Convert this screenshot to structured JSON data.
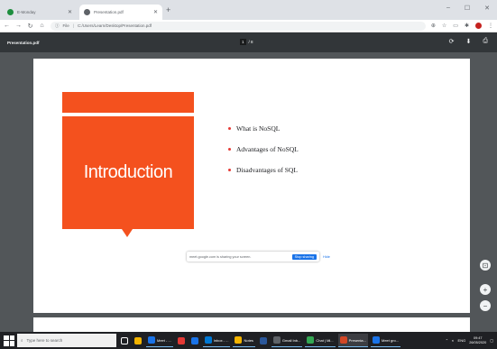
{
  "browser": {
    "tabs": [
      {
        "title": "E-Monday",
        "favicon_color": "#1e8e3e",
        "active": false
      },
      {
        "title": "Presentation.pdf",
        "favicon_color": "#5f6368",
        "active": true
      }
    ],
    "new_tab": "+",
    "window_controls": {
      "minimize": "–",
      "maximize": "☐",
      "close": "✕"
    },
    "nav": {
      "back": "←",
      "forward": "→",
      "reload": "↻",
      "home": "⌂"
    },
    "address": {
      "scheme": "File",
      "path": "C:/Users/Learn/Desktop/Presentation.pdf"
    }
  },
  "pdf_viewer": {
    "filename": "Presentation.pdf",
    "page_current": "1",
    "page_total": "/ 8",
    "icons": [
      "rotate-icon",
      "download-icon",
      "print-icon"
    ]
  },
  "slide": {
    "heading": "Introduction",
    "bullets": [
      "What is NoSQL",
      "Advantages of  NoSQL",
      "Disadvantages of SQL"
    ],
    "accent_color": "#f4511e"
  },
  "zoom": {
    "fit": "⊡",
    "in": "+",
    "out": "−"
  },
  "screen_share": {
    "message": "meet.google.com is sharing your screen.",
    "stop_label": "Stop sharing",
    "hide_label": "Hide"
  },
  "taskbar": {
    "search_placeholder": "Type here to search",
    "items": [
      {
        "label": "",
        "color": "#ffffff"
      },
      {
        "label": "",
        "color": "#ffffff"
      },
      {
        "label": "Meet - ...",
        "color": "#1a73e8"
      },
      {
        "label": "",
        "color": "#e53935"
      },
      {
        "label": "",
        "color": "#1a73e8"
      },
      {
        "label": "Inbox - ...",
        "color": "#0078d4"
      },
      {
        "label": "Notes",
        "color": "#f4b400"
      },
      {
        "label": "",
        "color": "#2b579a"
      },
      {
        "label": "Gmail Inb...",
        "color": "#5f6368"
      },
      {
        "label": "Chat | Mi...",
        "color": "#34a853"
      },
      {
        "label": "Presenta...",
        "color": "#d24726"
      },
      {
        "label": "Meet gro...",
        "color": "#1a73e8"
      }
    ],
    "tray_lang": "ENG",
    "time": "09:47",
    "date": "26/05/2020"
  }
}
